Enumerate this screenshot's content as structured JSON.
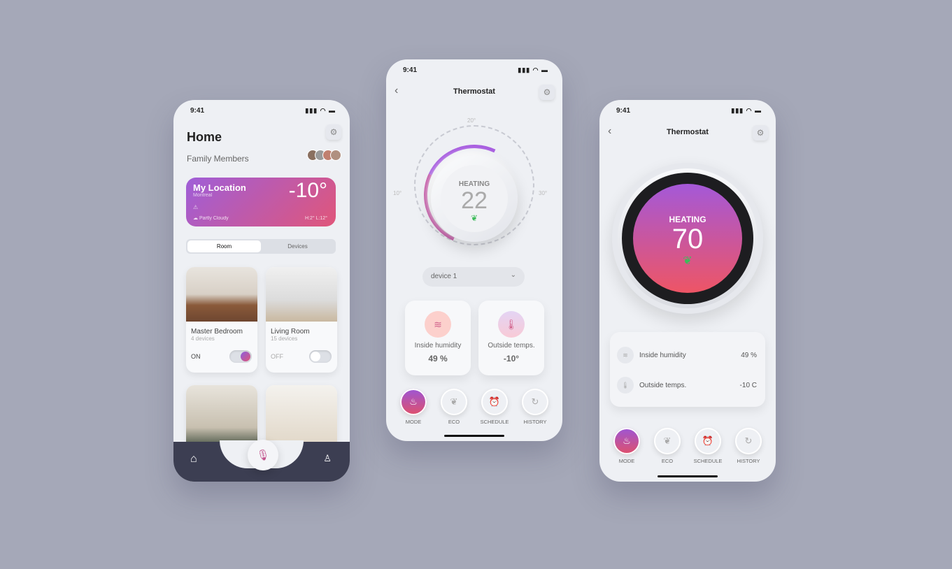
{
  "status_time": "9:41",
  "home": {
    "title": "Home",
    "family_label": "Family Members",
    "location": {
      "title": "My Location",
      "city": "Montreal",
      "temp": "-10°",
      "condition": "Partly Cloudy",
      "hi_lo": "H:2°  L:12°"
    },
    "segments": [
      "Room",
      "Devices"
    ],
    "active_segment": "Room",
    "rooms": [
      {
        "name": "Master Bedroom",
        "devices": "4 devices",
        "state": "ON",
        "on": true
      },
      {
        "name": "Living Room",
        "devices": "15 devices",
        "state": "OFF",
        "on": false
      }
    ]
  },
  "thermo1": {
    "title": "Thermostat",
    "mode": "HEATING",
    "value": "22",
    "ticks": {
      "top": "20°",
      "left": "10°",
      "right": "30°"
    },
    "device": "device 1",
    "cards": [
      {
        "label": "Inside humidity",
        "value": "49 %"
      },
      {
        "label": "Outside temps.",
        "value": "-10°"
      }
    ]
  },
  "thermo2": {
    "title": "Thermostat",
    "mode": "HEATING",
    "value": "70",
    "rows": [
      {
        "label": "Inside humidity",
        "value": "49 %"
      },
      {
        "label": "Outside temps.",
        "value": "-10 C"
      }
    ]
  },
  "modes": [
    "MODE",
    "ECO",
    "SCHEDULE",
    "HISTORY"
  ],
  "colors": {
    "background": "#a5a8b8",
    "gradient_start": "#9f5ed8",
    "gradient_end": "#e0567a",
    "eco": "#3dbb5a"
  }
}
